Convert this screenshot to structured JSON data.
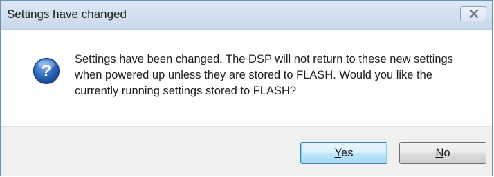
{
  "window": {
    "title": "Settings have changed",
    "close_icon": "close-icon"
  },
  "message": {
    "icon": "question-icon",
    "text": "Settings have been changed. The DSP will not return to these new settings when powered up unless they are stored to FLASH. Would you like the currently running settings stored to FLASH?"
  },
  "buttons": {
    "yes": {
      "accel": "Y",
      "rest": "es"
    },
    "no": {
      "accel": "N",
      "rest": "o"
    }
  },
  "colors": {
    "titlebar": "#d3e1f0",
    "footer": "#f0f0f0",
    "icon_blue": "#2d5fa8",
    "default_button_border": "#3c7fb1"
  }
}
